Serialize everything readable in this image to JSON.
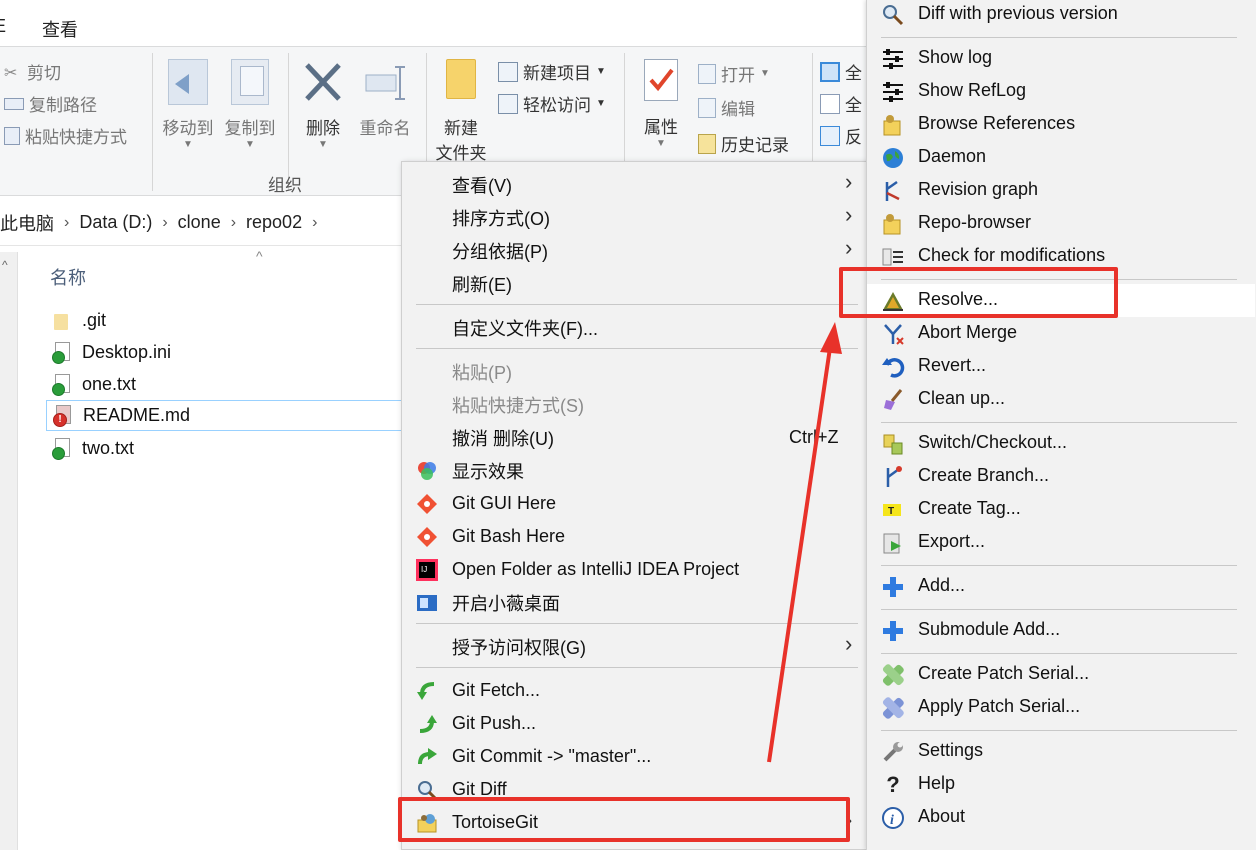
{
  "ribbon": {
    "tab_view": "查看",
    "cut": "剪切",
    "copy_path": "复制路径",
    "paste_shortcut": "粘贴快捷方式",
    "move_to": "移动到",
    "copy_to": "复制到",
    "delete": "删除",
    "rename": "重命名",
    "new_item": "新建项目",
    "easy_access": "轻松访问",
    "new_folder_line1": "新建",
    "new_folder_line2": "文件夹",
    "properties": "属性",
    "open": "打开",
    "edit": "编辑",
    "history": "历史记录",
    "select_all_1": "全",
    "select_all_2": "全",
    "invert": "反",
    "group_organize": "组织"
  },
  "address": {
    "crumbs": [
      "此电脑",
      "Data (D:)",
      "clone",
      "repo02"
    ]
  },
  "filelist": {
    "column_name": "名称",
    "files": [
      ".git",
      "Desktop.ini",
      "one.txt",
      "README.md",
      "two.txt"
    ]
  },
  "context_menu": {
    "items": [
      {
        "label": "查看(V)"
      },
      {
        "label": "排序方式(O)"
      },
      {
        "label": "分组依据(P)"
      },
      {
        "label": "刷新(E)"
      },
      {
        "label": "自定义文件夹(F)..."
      },
      {
        "label": "粘贴(P)"
      },
      {
        "label": "粘贴快捷方式(S)"
      },
      {
        "label": "撤消 删除(U)",
        "shortcut": "Ctrl+Z"
      },
      {
        "label": "显示效果"
      },
      {
        "label": "Git GUI Here"
      },
      {
        "label": "Git Bash Here"
      },
      {
        "label": "Open Folder as IntelliJ IDEA Project"
      },
      {
        "label": "开启小薇桌面"
      },
      {
        "label": "授予访问权限(G)"
      },
      {
        "label": "Git Fetch..."
      },
      {
        "label": "Git Push..."
      },
      {
        "label": "Git Commit -> \"master\"..."
      },
      {
        "label": "Git Diff"
      },
      {
        "label": "TortoiseGit"
      }
    ]
  },
  "submenu": {
    "items": [
      {
        "label": "Diff with previous version",
        "icon": "magnifier-icon"
      },
      {
        "label": "Show log",
        "icon": "log-icon"
      },
      {
        "label": "Show RefLog",
        "icon": "reflog-icon"
      },
      {
        "label": "Browse References",
        "icon": "references-icon"
      },
      {
        "label": "Daemon",
        "icon": "globe-icon"
      },
      {
        "label": "Revision graph",
        "icon": "revision-graph-icon"
      },
      {
        "label": "Repo-browser",
        "icon": "repo-browser-icon"
      },
      {
        "label": "Check for modifications",
        "icon": "check-modifications-icon"
      },
      {
        "label": "Resolve...",
        "icon": "resolve-icon"
      },
      {
        "label": "Abort Merge",
        "icon": "abort-merge-icon"
      },
      {
        "label": "Revert...",
        "icon": "revert-icon"
      },
      {
        "label": "Clean up...",
        "icon": "cleanup-icon"
      },
      {
        "label": "Switch/Checkout...",
        "icon": "switch-icon"
      },
      {
        "label": "Create Branch...",
        "icon": "branch-icon"
      },
      {
        "label": "Create Tag...",
        "icon": "tag-icon"
      },
      {
        "label": "Export...",
        "icon": "export-icon"
      },
      {
        "label": "Add...",
        "icon": "add-icon"
      },
      {
        "label": "Submodule Add...",
        "icon": "submodule-add-icon"
      },
      {
        "label": "Create Patch Serial...",
        "icon": "patch-create-icon"
      },
      {
        "label": "Apply Patch Serial...",
        "icon": "patch-apply-icon"
      },
      {
        "label": "Settings",
        "icon": "wrench-icon"
      },
      {
        "label": "Help",
        "icon": "help-icon"
      },
      {
        "label": "About",
        "icon": "info-icon"
      }
    ]
  },
  "colors": {
    "annotation_red": "#e8322a",
    "menu_bg": "#f2f2f2",
    "selection_border": "#99d1ff"
  }
}
